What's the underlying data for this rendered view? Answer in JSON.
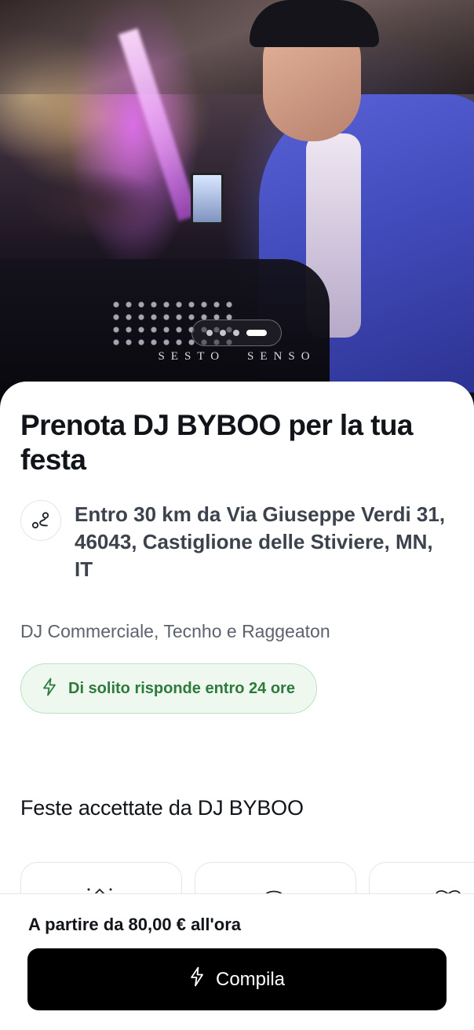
{
  "hero": {
    "brand_left": "SESTO",
    "brand_right": "SENSO",
    "carousel": {
      "count": 4,
      "active_index": 3
    }
  },
  "title": "Prenota DJ BYBOO per la tua festa",
  "location": {
    "icon": "route-icon",
    "text": "Entro 30 km da Via Giuseppe Verdi 31, 46043, Castiglione delle Stiviere, MN, IT"
  },
  "genres": "DJ Commerciale, Tecnho e Raggeaton",
  "response_badge": {
    "icon": "lightning-icon",
    "text": "Di solito risponde entro 24 ore",
    "colors": {
      "bg": "#eef8ef",
      "border": "#bfe0c3",
      "text": "#2e7a3d"
    }
  },
  "accepted_parties": {
    "title": "Feste accettate da DJ BYBOO"
  },
  "bottom_bar": {
    "price": "A partire da 80,00 € all'ora",
    "cta_label": "Compila",
    "cta_icon": "lightning-icon"
  }
}
